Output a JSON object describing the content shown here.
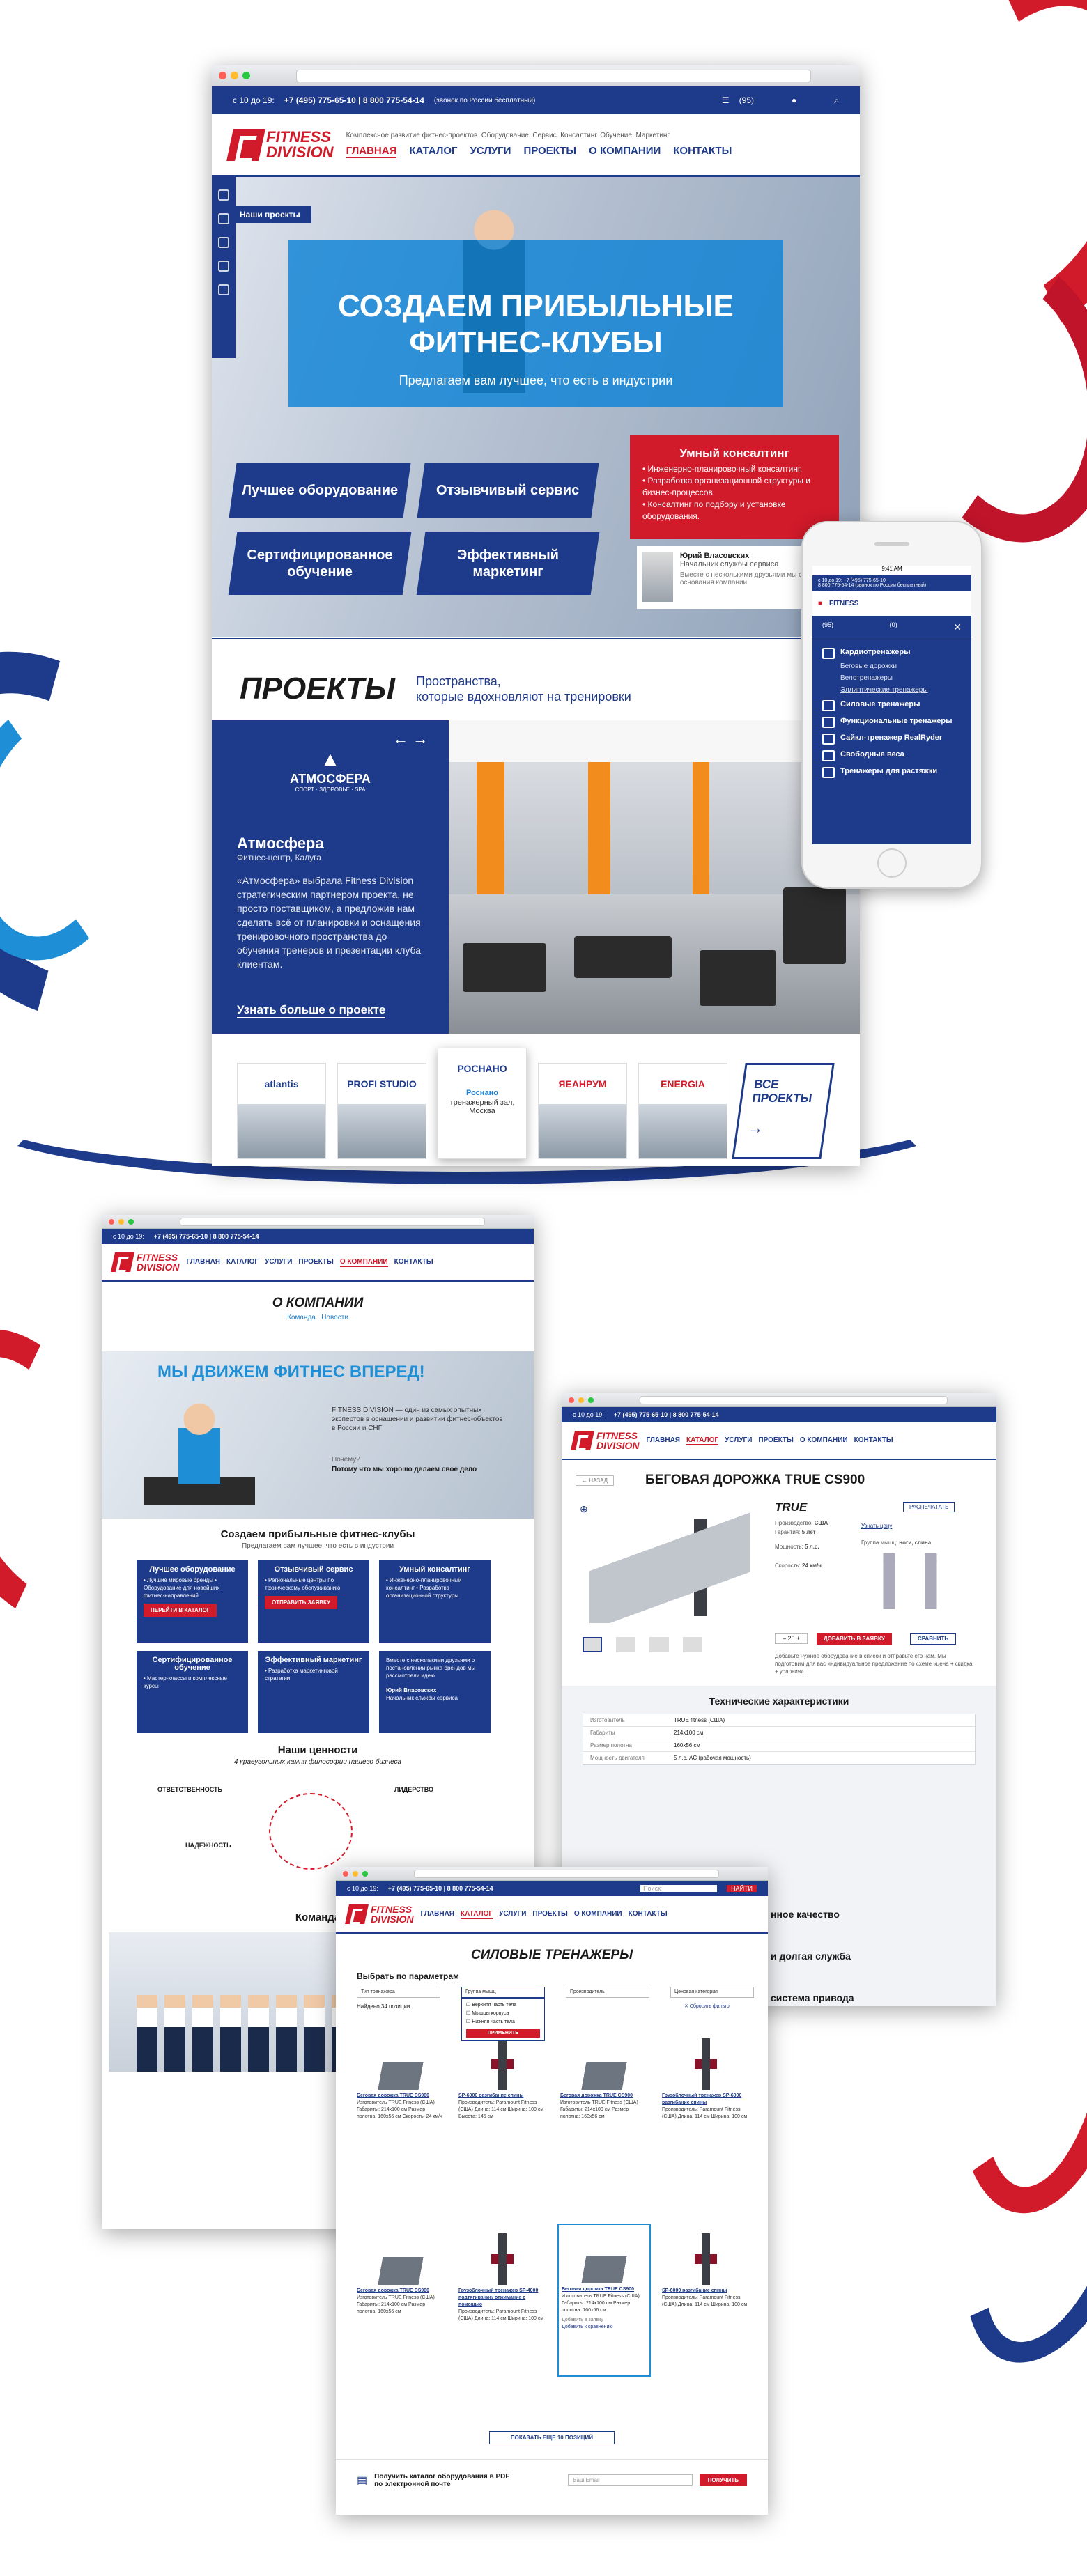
{
  "brand": {
    "line1": "FITNESS",
    "line2": "DIVISION",
    "tagline": "Комплексное развитие фитнес-проектов. Оборудование. Сервис. Консалтинг. Обучение. Маркетинг"
  },
  "topbar": {
    "hours": "с 10 до 19:",
    "phones": "+7 (495) 775-65-10 | 8 800 775-54-14",
    "note": "(звонок по России бесплатный)",
    "cart": "(95)"
  },
  "nav": [
    "ГЛАВНАЯ",
    "КАТАЛОГ",
    "УСЛУГИ",
    "ПРОЕКТЫ",
    "О КОМПАНИИ",
    "КОНТАКТЫ"
  ],
  "hero": {
    "title1": "СОЗДАЕМ ПРИБЫЛЬНЫЕ",
    "title2": "ФИТНЕС-КЛУБЫ",
    "subtitle": "Предлагаем вам лучшее, что есть в индустрии",
    "pill": "Наши проекты"
  },
  "cards": [
    "Лучшее оборудование",
    "Отзывчивый сервис",
    "Сертифицированное обучение",
    "Эффективный маркетинг"
  ],
  "consult": {
    "title": "Умный консалтинг",
    "items": [
      "• Инженерно-планировочный консалтинг.",
      "• Разработка организационной структуры и бизнес-процессов",
      "• Консалтинг по подбору и установке оборудования."
    ]
  },
  "person": {
    "name": "Юрий Власовских",
    "role": "Начальник службы сервиса",
    "quote": "Вместе с несколькими друзьями мы с позиции основания компании"
  },
  "projects": {
    "title": "ПРОЕКТЫ",
    "subtitle1": "Пространства,",
    "subtitle2": "которые вдохновляют на тренировки",
    "club_logo": "АТМОСФЕРА",
    "club_logo_sub": "СПОРТ · ЗДОРОВЬЕ · SPA",
    "name": "Атмосфера",
    "place": "Фитнес-центр, Калуга",
    "desc": "«Атмосфера» выбрала Fitness Division стратегическим партнером проекта, не просто поставщиком, а предложив нам сделать всё от планировки и оснащения тренировочного пространства до обучения тренеров и презентации клуба клиентам.",
    "more": "Узнать больше о проекте",
    "all": "ВСЕ ПРОЕКТЫ",
    "thumbs": [
      "atlantis",
      "PROFI STUDIO",
      "РОСНАНО",
      "ЯЕАНРУМ",
      "ENERGIA"
    ],
    "hover_name": "Роснано",
    "hover_desc": "тренажерный зал, Москва"
  },
  "phone": {
    "time": "9:41 AM",
    "phones": "с 10 до 19: +7 (495) 775-65-10",
    "phones2": "8 800 775-54-14 (звонок по России бесплатный)",
    "cart": "(95)",
    "cart2": "(0)",
    "menu": [
      {
        "label": "Кардиотренажеры",
        "subs": [
          "Беговые дорожки",
          "Велотренажеры",
          "Эллиптические тренажеры"
        ]
      },
      {
        "label": "Силовые тренажеры",
        "subs": []
      },
      {
        "label": "Функциональные тренажеры",
        "subs": []
      },
      {
        "label": "Сайкл-тренажер RealRyder",
        "subs": []
      },
      {
        "label": "Свободные веса",
        "subs": []
      },
      {
        "label": "Тренажеры для растяжки",
        "subs": []
      }
    ]
  },
  "about": {
    "title": "О КОМПАНИИ",
    "tabs": [
      "Команда",
      "Новости"
    ],
    "banner": "МЫ ДВИЖЕМ ФИТНЕС ВПЕРЕД!",
    "intro": "FITNESS DIVISION — один из самых опытных экспертов в оснащении и развитии фитнес-объектов в России и СНГ",
    "why": "Почему?",
    "why_ans": "Потому что мы хорошо делаем свое дело",
    "h": "Создаем прибыльные фитнес-клубы",
    "hs": "Предлагаем вам лучшее, что есть в индустрии",
    "boxes": [
      {
        "t": "Лучшее оборудование",
        "b": "• Лучшие мировые бренды • Оборудование для новейших фитнес-направлений"
      },
      {
        "t": "Отзывчивый сервис",
        "b": "• Региональные центры по техническому обслуживанию"
      },
      {
        "t": "Умный консалтинг",
        "b": "• Инженерно-планировочный консалтинг • Разработка организационной структуры"
      },
      {
        "t": "Сертифицированное обучение",
        "b": "• Мастер-классы и комплексные курсы"
      },
      {
        "t": "Эффективный маркетинг",
        "b": "• Разработка маркетинговой стратегии"
      },
      {
        "t": "",
        "b": "Вместе с несколькими друзьями о постановлении рынка брендов мы рассмотрели идею"
      }
    ],
    "btn1": "ПЕРЕЙТИ В КАТАЛОГ",
    "btn2": "ОТПРАВИТЬ ЗАЯВКУ",
    "values_title": "Наши ценности",
    "values_sub": "4 краеугольных камня философии нашего бизнеса",
    "v1": "ОТВЕТСТВЕННОСТЬ",
    "v2": "НАДЕЖНОСТЬ",
    "v3": "ЛИДЕРСТВО",
    "team": "Команда",
    "person": "Юрий Власовских",
    "person_role": "Начальник службы сервиса"
  },
  "product": {
    "back": "← НАЗАД",
    "title": "БЕГОВАЯ ДОРОЖКА TRUE CS900",
    "brand": "TRUE",
    "country_l": "Производство:",
    "country": "США",
    "warranty_l": "Гарантия:",
    "warranty": "5 лет",
    "power_l": "Мощность:",
    "power": "5 л.с.",
    "speed_l": "Скорость:",
    "speed": "24 км/ч",
    "muscle_l": "Группа мышц:",
    "muscle": "ноги, спина",
    "price": "Узнать цену",
    "print": "РАСПЕЧАТАТЬ",
    "qty": "25",
    "add": "ДОБАВИТЬ В ЗАЯВКУ",
    "compare": "СРАВНИТЬ",
    "note": "Добавьте нужное оборудование в список и отправьте его нам. Мы подготовим для вас индивидуальное предложение по схеме «цена + скидка + условия».",
    "specs_title": "Технические характеристики",
    "specs": [
      [
        "Изготовитель",
        "TRUE fitness (США)"
      ],
      [
        "Габариты",
        "214х100 см"
      ],
      [
        "Размер полотна",
        "160х56 см"
      ],
      [
        "Мощность двигателя",
        "5 л.с. AC (рабочая мощность)"
      ]
    ],
    "s2": "нное качество",
    "s3": "и долгая служба",
    "s4": "система привода"
  },
  "catalog": {
    "title": "СИЛОВЫЕ ТРЕНАЖЕРЫ",
    "filter": "Выбрать по параметрам",
    "selects": [
      "Тип тренажера",
      "Группа мышц",
      "Производитель",
      "Ценовая категория"
    ],
    "checks": [
      "Верхняя часть тела",
      "Мышцы корпуса",
      "Нижняя часть тела"
    ],
    "apply": "ПРИМЕНИТЬ",
    "found": "Найдено 34 позиции",
    "reset": "✕ Сбросить фильтр",
    "search": "Поиск",
    "find": "НАЙТИ",
    "items": [
      {
        "n": "Беговая дорожка TRUE CS900",
        "t": "tm",
        "d": "Изготовитель TRUE Fitness (США) Габариты: 214х100 см Размер полотна: 160х56 см Скорость: 24 км/ч"
      },
      {
        "n": "SP-6000 разгибание спины",
        "t": "pw",
        "d": "Производитель: Paramount Fitness (США) Длина: 114 см Ширина: 100 см Высота: 145 см"
      },
      {
        "n": "Беговая дорожка TRUE CS900",
        "t": "tm",
        "d": "Изготовитель TRUE Fitness (США) Габариты: 214х100 см Размер полотна: 160х56 см"
      },
      {
        "n": "Грузоблочный тренажер SP-6000 разгибание спины",
        "t": "pw",
        "d": "Производитель: Paramount Fitness (США) Длина: 114 см Ширина: 100 см"
      },
      {
        "n": "Беговая дорожка TRUE CS900",
        "t": "tm",
        "d": "Изготовитель TRUE Fitness (США) Габариты: 214х100 см Размер полотна: 160х56 см"
      },
      {
        "n": "Грузоблочный тренажер SP-4000 подтягивание/ отжимание с помощью",
        "t": "pw",
        "d": "Производитель: Paramount Fitness (США) Длина: 114 см Ширина: 100 см"
      },
      {
        "n": "Беговая дорожка TRUE CS900",
        "t": "tm",
        "d": "Изготовитель TRUE Fitness (США) Габариты: 214х100 см Размер полотна: 160х56 см"
      },
      {
        "n": "SP-6000 разгибание спины",
        "t": "pw",
        "d": "Производитель: Paramount Fitness (США) Длина: 114 см Ширина: 100 см"
      }
    ],
    "add": "Добавить в заявку",
    "cmp": "Добавить к сравнению",
    "more": "ПОКАЗАТЬ ЕЩЕ 10 ПОЗИЦИЙ",
    "pdf": "Получить каталог оборудования в PDF по электронной почте",
    "email_ph": "Ваш Email",
    "get": "ПОЛУЧИТЬ"
  },
  "colors": {
    "blue": "#1e3a8a",
    "red": "#d11a2a",
    "sky": "#0d82d6"
  }
}
